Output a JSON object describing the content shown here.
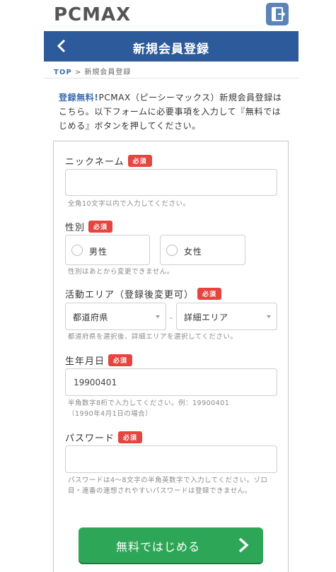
{
  "brand": {
    "logo_text": "PCMAX"
  },
  "header": {
    "title": "新規会員登録",
    "back_icon": "chevron-left-icon",
    "logout_icon": "logout-icon"
  },
  "breadcrumb": {
    "top": "TOP",
    "separator": ">",
    "current": "新規会員登録"
  },
  "intro": {
    "free_label": "登録無料!",
    "text": "PCMAX（ピーシーマックス）新規会員登録はこちら。以下フォームに必要事項を入力して『無料ではじめる』ボタンを押してください。"
  },
  "badge_required": "必須",
  "form": {
    "nickname": {
      "label": "ニックネーム",
      "value": "",
      "hint": "全角10文字以内で入力してください。"
    },
    "gender": {
      "label": "性別",
      "options": [
        "男性",
        "女性"
      ],
      "hint": "性別はあとから変更できません。"
    },
    "area": {
      "label": "活動エリア（登録後変更可）",
      "prefecture": "都道府県",
      "separator": "-",
      "detail": "詳細エリア",
      "hint": "都道府県を選択後、詳細エリアを選択してください。"
    },
    "birthday": {
      "label": "生年月日",
      "value": "19900401",
      "hint_line1": "半角数字8桁で入力してください。例：19900401",
      "hint_line2": "（1990年4月1日の場合）"
    },
    "password": {
      "label": "パスワード",
      "value": "",
      "hint": "パスワードは4～8文字の半角英数字で入力してください。ゾロ目・連番の連想されやすいパスワードは登録できません。"
    }
  },
  "submit": {
    "label": "無料ではじめる",
    "icon": "chevron-right-icon"
  },
  "colors": {
    "header_bg": "#2d5a9a",
    "badge": "#e5453f",
    "submit": "#2ea658",
    "link": "#3b6fb0"
  }
}
